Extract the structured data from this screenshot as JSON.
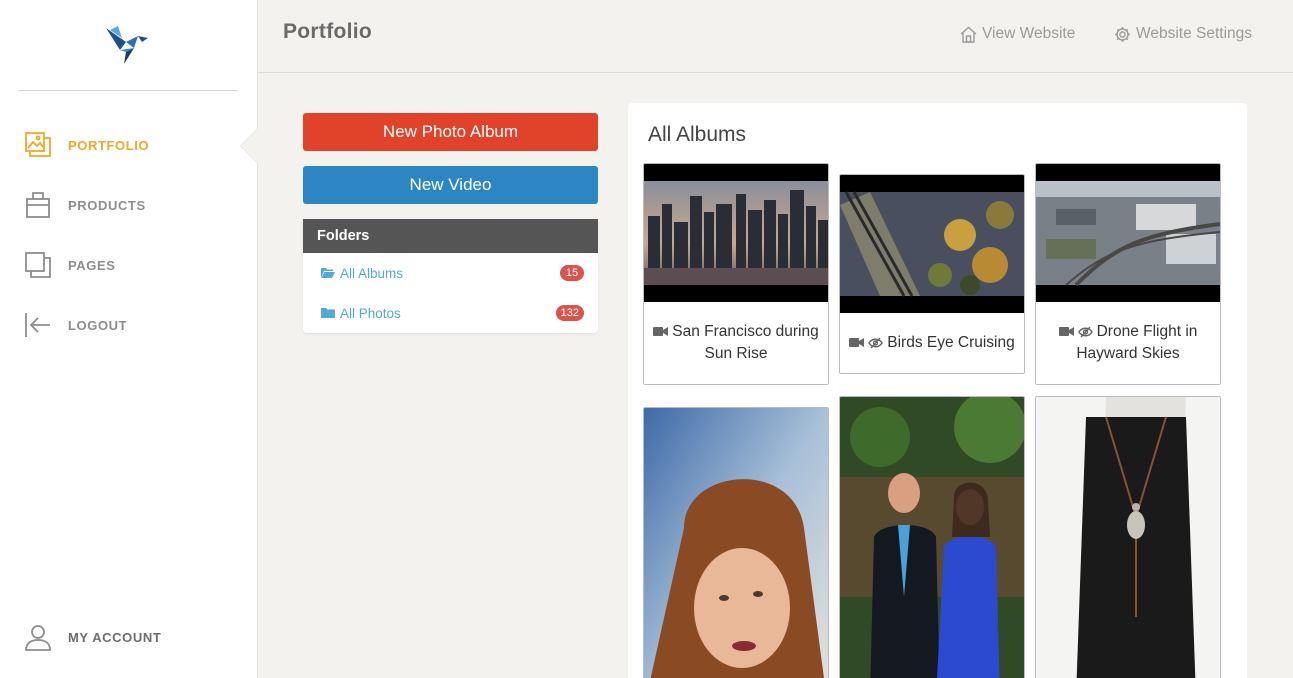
{
  "sidebar": {
    "items": [
      {
        "label": "PORTFOLIO",
        "icon": "images-icon",
        "active": true
      },
      {
        "label": "PRODUCTS",
        "icon": "bag-icon",
        "active": false
      },
      {
        "label": "PAGES",
        "icon": "pages-icon",
        "active": false
      },
      {
        "label": "LOGOUT",
        "icon": "logout-icon",
        "active": false
      }
    ],
    "account": {
      "label": "MY ACCOUNT",
      "icon": "user-icon"
    }
  },
  "header": {
    "title": "Portfolio",
    "view_website": "View Website",
    "website_settings": "Website Settings"
  },
  "actions": {
    "new_photo_album": "New Photo Album",
    "new_video": "New Video"
  },
  "folders": {
    "title": "Folders",
    "items": [
      {
        "label": "All Albums",
        "count": "15"
      },
      {
        "label": "All Photos",
        "count": "132"
      }
    ]
  },
  "albums": {
    "title": "All Albums",
    "cards": [
      {
        "caption": "San Francisco during Sun Rise",
        "icons": [
          "video-icon"
        ]
      },
      {
        "caption": "Birds Eye Cruising",
        "icons": [
          "video-icon",
          "hidden-eye-icon"
        ]
      },
      {
        "caption": "Drone Flight in Hayward Skies",
        "icons": [
          "video-icon",
          "hidden-eye-icon"
        ]
      },
      {
        "caption": "",
        "icons": []
      },
      {
        "caption": "",
        "icons": []
      },
      {
        "caption": "",
        "icons": []
      }
    ]
  },
  "colors": {
    "accent": "#f0a828",
    "red_button": "#e0432a",
    "blue_button": "#2c86c4",
    "link": "#52a9d8",
    "badge": "#d9534f"
  }
}
